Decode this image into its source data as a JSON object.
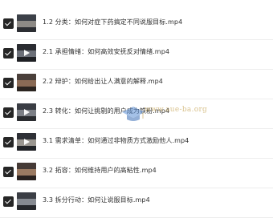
{
  "lessons": [
    {
      "title": "1.2 分类：如何对症下药搞定不同说服目标.mp4",
      "checked": true,
      "thumb_icon": "video-thumbnail-icon",
      "colors": [
        "#3c4048",
        "#8d8a86",
        "#2c2e33"
      ]
    },
    {
      "title": "2.1 承担情绪：如何高效安抚反对情绪.mp4",
      "checked": true,
      "thumb_icon": "video-thumbnail-icon",
      "colors": [
        "#2a2c31",
        "#6b6f78",
        "#1e2024"
      ]
    },
    {
      "title": "2.2 辩护：如何给出让人满意的解释.mp4",
      "checked": true,
      "thumb_icon": "video-thumbnail-icon",
      "colors": [
        "#4a3f3a",
        "#8a6a55",
        "#2b2420"
      ]
    },
    {
      "title": "2.3 转化：如何让挑剔的用户成为铁粉.mp4",
      "checked": true,
      "thumb_icon": "video-thumbnail-icon",
      "colors": [
        "#3a3d44",
        "#7c7f86",
        "#2a2c30"
      ]
    },
    {
      "title": "3.1 需求清单：如何通过非物质方式激励他人.mp4",
      "checked": true,
      "thumb_icon": "video-thumbnail-icon",
      "colors": [
        "#2e3036",
        "#9a9690",
        "#222428"
      ]
    },
    {
      "title": "3.2 拓容：如何维持用户的高粘性.mp4",
      "checked": true,
      "thumb_icon": "video-thumbnail-icon",
      "colors": [
        "#453a36",
        "#9b7a62",
        "#2a2220"
      ]
    },
    {
      "title": "3.3 拆分行动：如何让说服目标.mp4",
      "checked": true,
      "thumb_icon": "video-thumbnail-icon",
      "colors": [
        "#3b3e45",
        "#868a91",
        "#26282c"
      ]
    }
  ],
  "watermark": {
    "text": "www.aue-ba.org"
  }
}
